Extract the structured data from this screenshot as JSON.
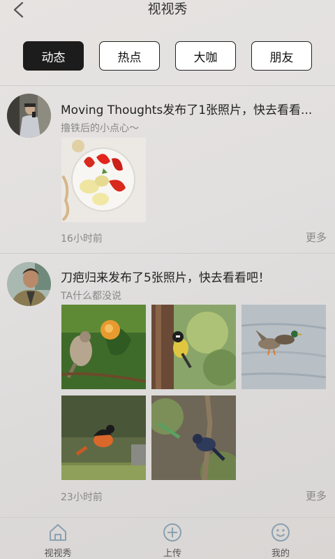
{
  "header": {
    "title": "视视秀",
    "back_icon": "chevron-left-icon"
  },
  "tabs": [
    {
      "label": "动态",
      "active": true
    },
    {
      "label": "热点",
      "active": false
    },
    {
      "label": "大咖",
      "active": false
    },
    {
      "label": "朋友",
      "active": false
    }
  ],
  "posts": [
    {
      "title": "Moving Thoughts发布了1张照片，快去看看...",
      "subtitle": "撸铁后的小点心～",
      "photos": [
        "plate-of-fruit-photo"
      ],
      "time": "16小时前",
      "more_label": "更多"
    },
    {
      "title": "刀疤归来发布了5张照片，快去看看吧！",
      "subtitle": "TA什么都没说",
      "photos": [
        "bird-flower-photo",
        "bird-trunk-photo",
        "ducks-water-photo",
        "redstart-photo",
        "blue-bird-branch-photo"
      ],
      "time": "23小时前",
      "more_label": "更多"
    }
  ],
  "bottom_nav": [
    {
      "label": "视视秀",
      "icon": "home-icon"
    },
    {
      "label": "上传",
      "icon": "plus-circle-icon"
    },
    {
      "label": "我的",
      "icon": "smiley-icon"
    }
  ],
  "colors": {
    "active_tab_bg": "#1c1c1c",
    "icon_stroke": "#8aa0b0"
  }
}
